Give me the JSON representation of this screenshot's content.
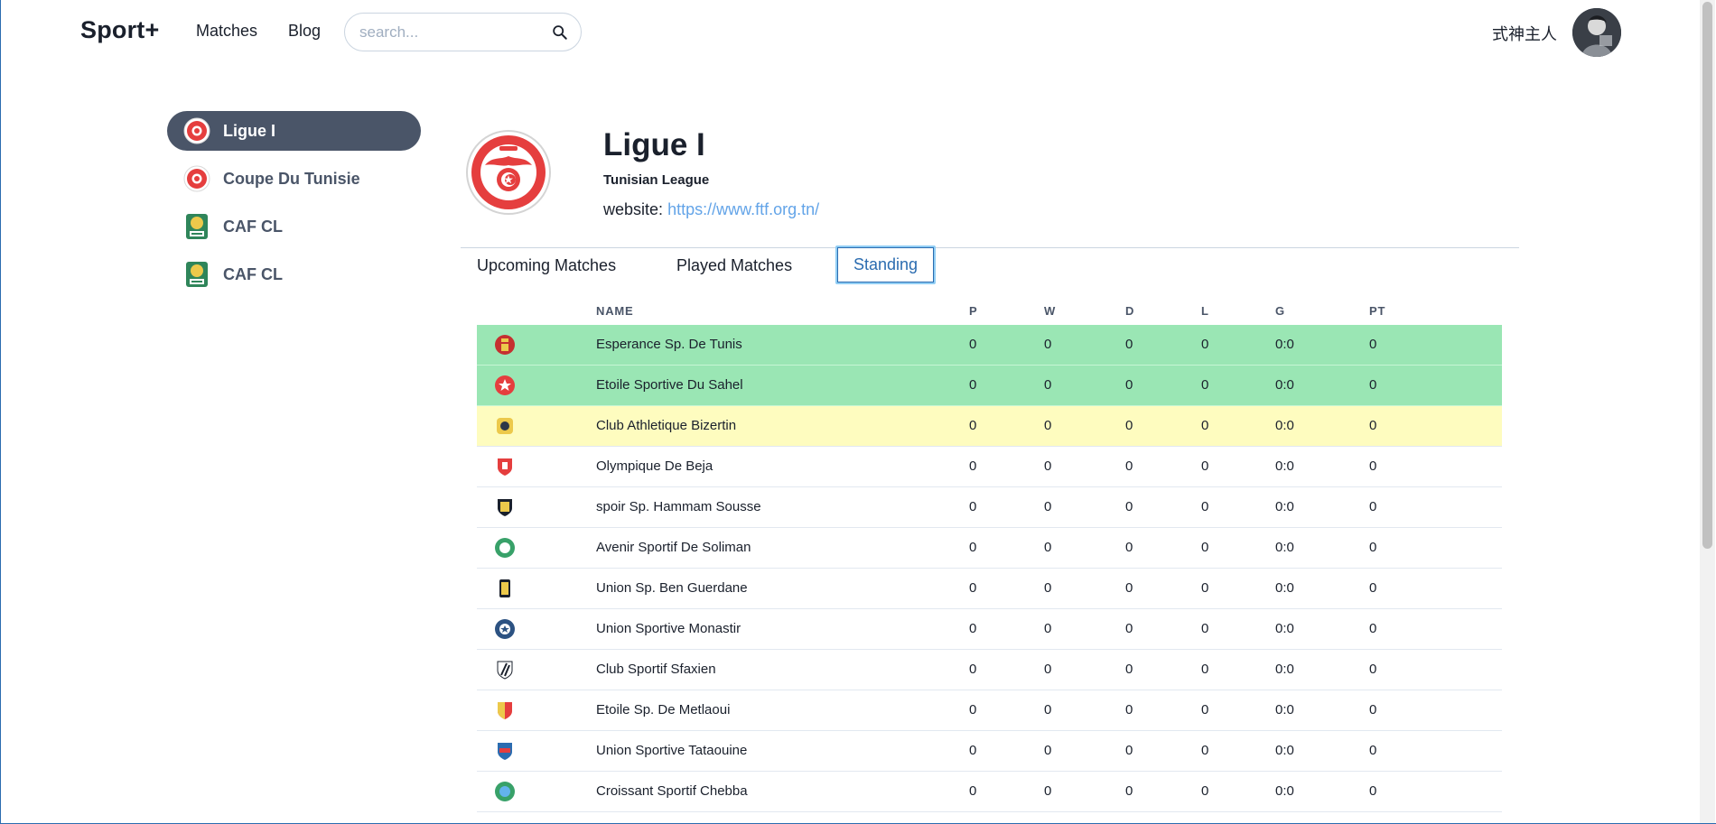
{
  "header": {
    "brand": "Sport+",
    "nav": {
      "matches": "Matches",
      "blog": "Blog"
    },
    "search": {
      "placeholder": "search...",
      "value": ""
    },
    "username": "式神主人"
  },
  "sidebar": {
    "items": [
      {
        "label": "Ligue I",
        "active": true,
        "icon": "ftf-logo-icon"
      },
      {
        "label": "Coupe Du Tunisie",
        "active": false,
        "icon": "ftf-logo-icon"
      },
      {
        "label": "CAF CL",
        "active": false,
        "icon": "caf-logo-icon"
      },
      {
        "label": "CAF CL",
        "active": false,
        "icon": "caf-logo-icon"
      }
    ]
  },
  "league": {
    "name": "Ligue I",
    "country": "Tunisian League",
    "website_label": "website:",
    "website_url": "https://www.ftf.org.tn/"
  },
  "tabs": {
    "upcoming": "Upcoming Matches",
    "played": "Played Matches",
    "standing": "Standing",
    "active": "standing"
  },
  "standings": {
    "columns": {
      "name": "NAME",
      "p": "P",
      "w": "W",
      "d": "D",
      "l": "L",
      "g": "G",
      "pt": "PT"
    },
    "rows": [
      {
        "name": "Esperance Sp. De Tunis",
        "p": "0",
        "w": "0",
        "d": "0",
        "l": "0",
        "g": "0:0",
        "pt": "0",
        "highlight": "green"
      },
      {
        "name": "Etoile Sportive Du Sahel",
        "p": "0",
        "w": "0",
        "d": "0",
        "l": "0",
        "g": "0:0",
        "pt": "0",
        "highlight": "green"
      },
      {
        "name": "Club Athletique Bizertin",
        "p": "0",
        "w": "0",
        "d": "0",
        "l": "0",
        "g": "0:0",
        "pt": "0",
        "highlight": "yellow"
      },
      {
        "name": "Olympique De Beja",
        "p": "0",
        "w": "0",
        "d": "0",
        "l": "0",
        "g": "0:0",
        "pt": "0",
        "highlight": "none"
      },
      {
        "name": "spoir Sp. Hammam Sousse",
        "p": "0",
        "w": "0",
        "d": "0",
        "l": "0",
        "g": "0:0",
        "pt": "0",
        "highlight": "none"
      },
      {
        "name": "Avenir Sportif De Soliman",
        "p": "0",
        "w": "0",
        "d": "0",
        "l": "0",
        "g": "0:0",
        "pt": "0",
        "highlight": "none"
      },
      {
        "name": "Union Sp. Ben Guerdane",
        "p": "0",
        "w": "0",
        "d": "0",
        "l": "0",
        "g": "0:0",
        "pt": "0",
        "highlight": "none"
      },
      {
        "name": "Union Sportive Monastir",
        "p": "0",
        "w": "0",
        "d": "0",
        "l": "0",
        "g": "0:0",
        "pt": "0",
        "highlight": "none"
      },
      {
        "name": "Club Sportif Sfaxien",
        "p": "0",
        "w": "0",
        "d": "0",
        "l": "0",
        "g": "0:0",
        "pt": "0",
        "highlight": "none"
      },
      {
        "name": "Etoile Sp. De Metlaoui",
        "p": "0",
        "w": "0",
        "d": "0",
        "l": "0",
        "g": "0:0",
        "pt": "0",
        "highlight": "none"
      },
      {
        "name": "Union Sportive Tataouine",
        "p": "0",
        "w": "0",
        "d": "0",
        "l": "0",
        "g": "0:0",
        "pt": "0",
        "highlight": "none"
      },
      {
        "name": "Croissant Sportif Chebba",
        "p": "0",
        "w": "0",
        "d": "0",
        "l": "0",
        "g": "0:0",
        "pt": "0",
        "highlight": "none"
      }
    ]
  },
  "colors": {
    "accent": "#4a5568",
    "link": "#63a4e8",
    "row_green": "#9ae6b4",
    "row_yellow": "#fefcbf",
    "tab_active": "#2b6cb0"
  }
}
